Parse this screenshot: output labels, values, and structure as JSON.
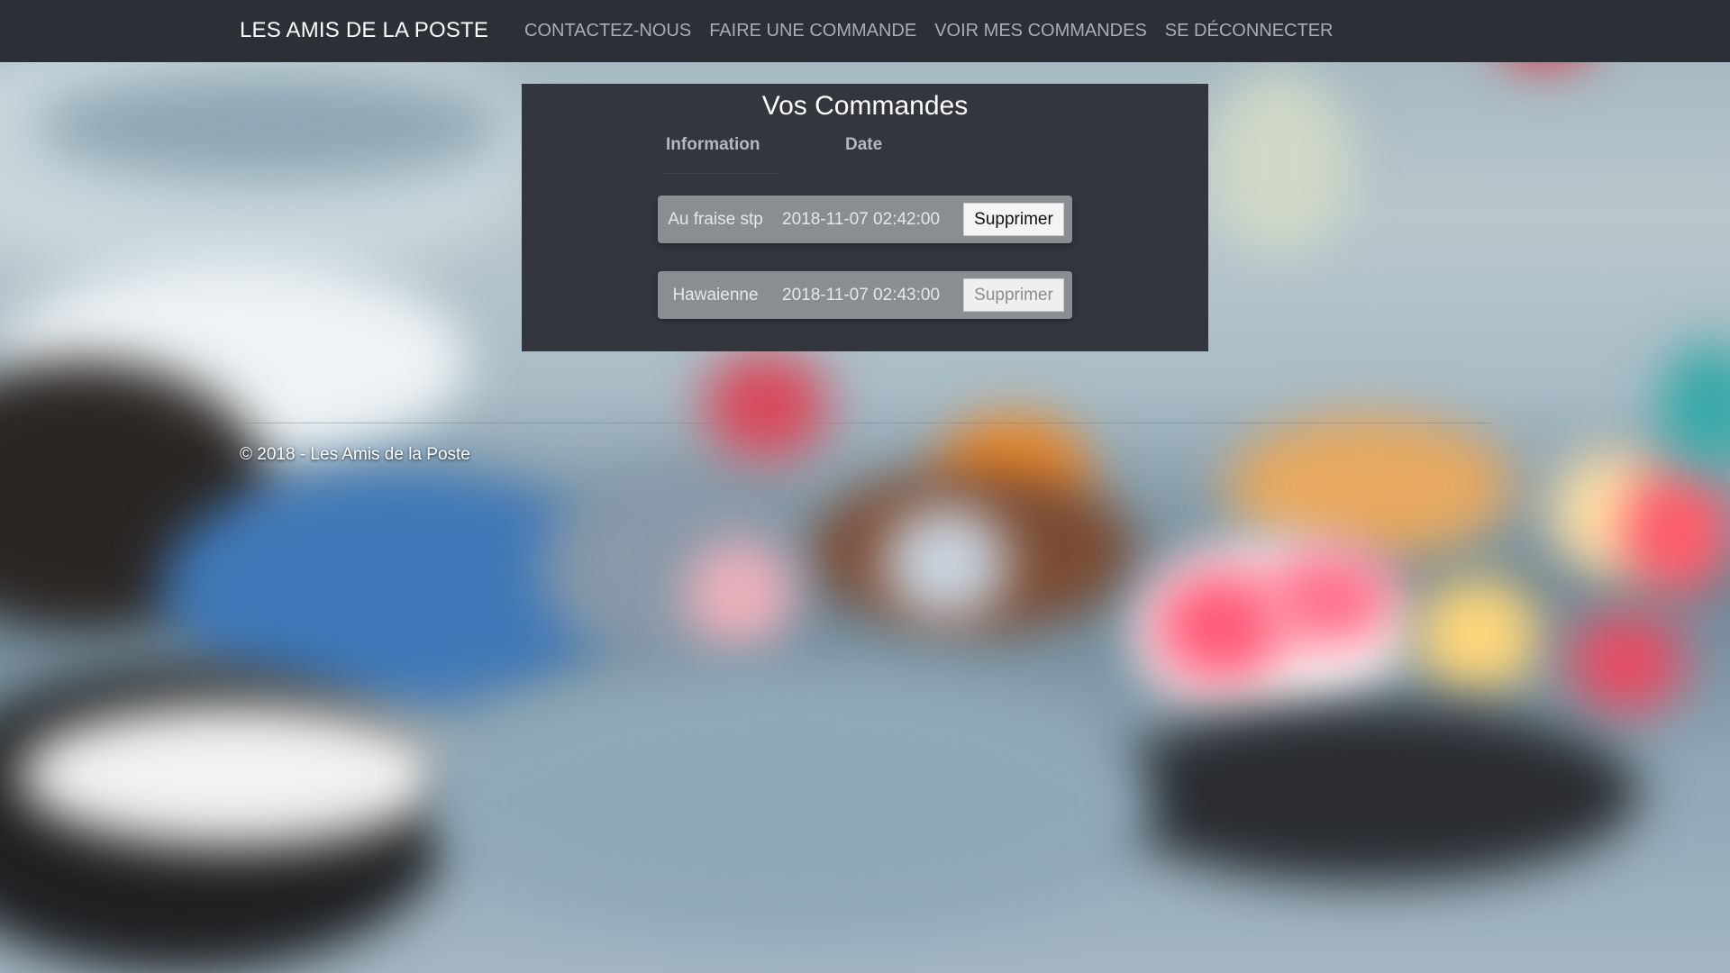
{
  "navbar": {
    "brand": "LES AMIS DE LA POSTE",
    "links": [
      {
        "label": "CONTACTEZ-NOUS"
      },
      {
        "label": "FAIRE UNE COMMANDE"
      },
      {
        "label": "VOIR MES COMMANDES"
      },
      {
        "label": "SE DÉCONNECTER"
      }
    ]
  },
  "orders": {
    "title": "Vos Commandes",
    "columns": {
      "information": "Information",
      "date": "Date"
    },
    "rows": [
      {
        "information": "Au fraise stp",
        "date": "2018-11-07 02:42:00",
        "delete_label": "Supprimer"
      },
      {
        "information": "Hawaienne",
        "date": "2018-11-07 02:43:00",
        "delete_label": "Supprimer"
      }
    ]
  },
  "footer": {
    "text": "© 2018 - Les Amis de la Poste"
  },
  "colors": {
    "navbar_bg": "#2c3036",
    "panel_bg": "#33373d",
    "row_bg": "#8a8d92",
    "nav_link": "#a9adb1"
  }
}
